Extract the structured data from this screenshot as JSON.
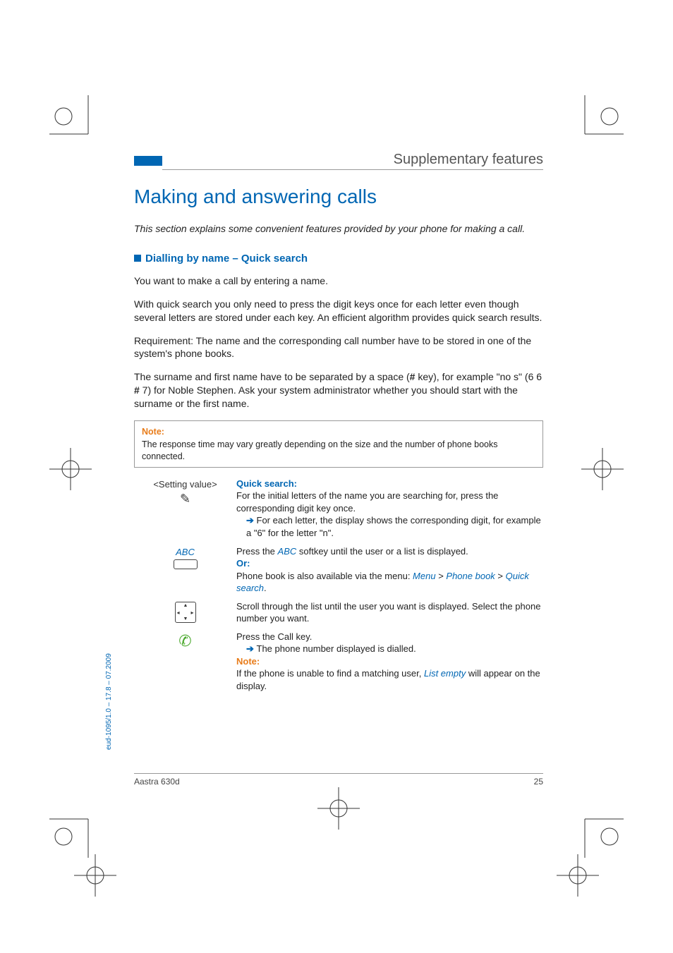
{
  "header": {
    "section_title": "Supplementary features"
  },
  "title": "Making and answering calls",
  "intro": "This section explains some convenient features provided by your phone for making a call.",
  "subheading": "Dialling by name – Quick search",
  "paragraphs": {
    "p1": "You want to make a call by entering a name.",
    "p2": "With quick search you only need to press the digit keys once for each letter even though several letters are stored under each key. An efficient algorithm provides quick search results.",
    "p3": "Requirement: The name and the corresponding call number have to be stored in one of the system's phone books.",
    "p4_a": "The surname and first name have to be separated by a space (",
    "p4_hash": "#",
    "p4_b": " key), for example \"no s\" (6 6 ",
    "p4_c": " 7) for Noble Stephen. Ask your system administrator whether you should start with the surname or the first name."
  },
  "note_box": {
    "label": "Note:",
    "text": "The response time may vary greatly depending on the size and the number of phone books connected."
  },
  "steps": {
    "s1": {
      "left": "<Setting value>",
      "heading": "Quick search:",
      "line1": "For the initial letters of the name you are searching for, press the corresponding digit key once.",
      "line2": "For each letter, the display shows the corresponding digit, for example a \"6\" for the letter \"n\"."
    },
    "s2": {
      "left": "ABC",
      "line1a": "Press the ",
      "abc": "ABC",
      "line1b": " softkey until the user or a list is displayed.",
      "or": "Or:",
      "line2a": "Phone book is also available via the menu: ",
      "menu": "Menu",
      "gt1": " > ",
      "pb": "Phone book",
      "gt2": " > ",
      "qs": "Quick search",
      "period": "."
    },
    "s3": {
      "line1": "Scroll through the list until the user you want is displayed. Select the phone number you want."
    },
    "s4": {
      "line1": "Press the Call key.",
      "line2": "The phone number displayed is dialled.",
      "note": "Note:",
      "line3a": "If the phone is unable to find a matching user, ",
      "list_empty": "List empty",
      "line3b": " will appear on the display."
    }
  },
  "footer": {
    "model": "Aastra 630d",
    "page": "25"
  },
  "side": "eud-1095/1.0 – 17.8 – 07.2009"
}
